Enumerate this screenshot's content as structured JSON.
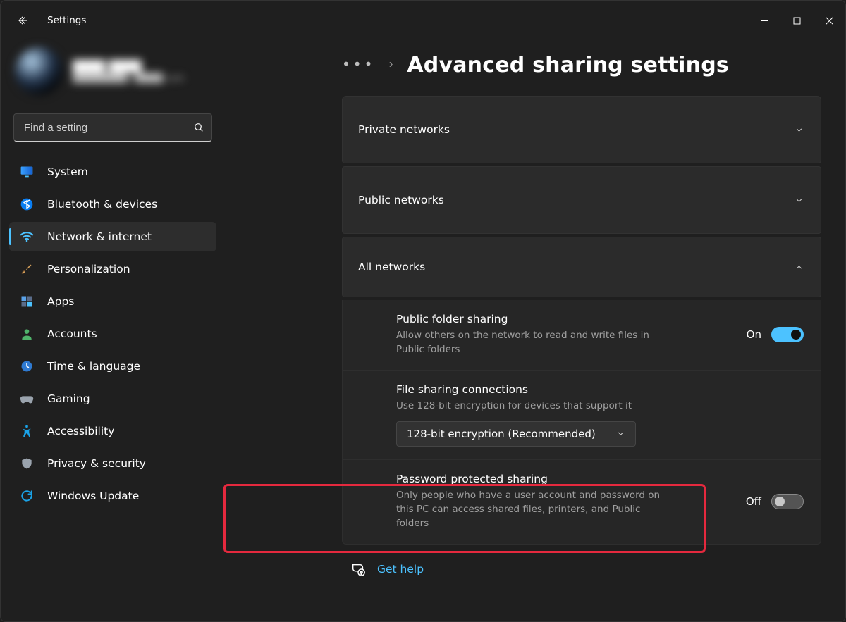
{
  "app": {
    "title": "Settings"
  },
  "profile": {
    "name": "████ ████",
    "email": "████████@████.com"
  },
  "search": {
    "placeholder": "Find a setting"
  },
  "nav": {
    "items": [
      {
        "label": "System"
      },
      {
        "label": "Bluetooth & devices"
      },
      {
        "label": "Network & internet"
      },
      {
        "label": "Personalization"
      },
      {
        "label": "Apps"
      },
      {
        "label": "Accounts"
      },
      {
        "label": "Time & language"
      },
      {
        "label": "Gaming"
      },
      {
        "label": "Accessibility"
      },
      {
        "label": "Privacy & security"
      },
      {
        "label": "Windows Update"
      }
    ],
    "selected_index": 2
  },
  "page": {
    "title": "Advanced sharing settings"
  },
  "sections": {
    "private": {
      "title": "Private networks",
      "expanded": false
    },
    "public": {
      "title": "Public networks",
      "expanded": false
    },
    "all": {
      "title": "All networks",
      "expanded": true,
      "public_folder_sharing": {
        "label": "Public folder sharing",
        "desc": "Allow others on the network to read and write files in Public folders",
        "state_text": "On",
        "on": true
      },
      "file_sharing_connections": {
        "label": "File sharing connections",
        "desc": "Use 128-bit encryption for devices that support it",
        "selected": "128-bit encryption (Recommended)"
      },
      "password_protected_sharing": {
        "label": "Password protected sharing",
        "desc": "Only people who have a user account and password on this PC can access shared files, printers, and Public folders",
        "state_text": "Off",
        "on": false
      }
    }
  },
  "help": {
    "label": "Get help"
  }
}
